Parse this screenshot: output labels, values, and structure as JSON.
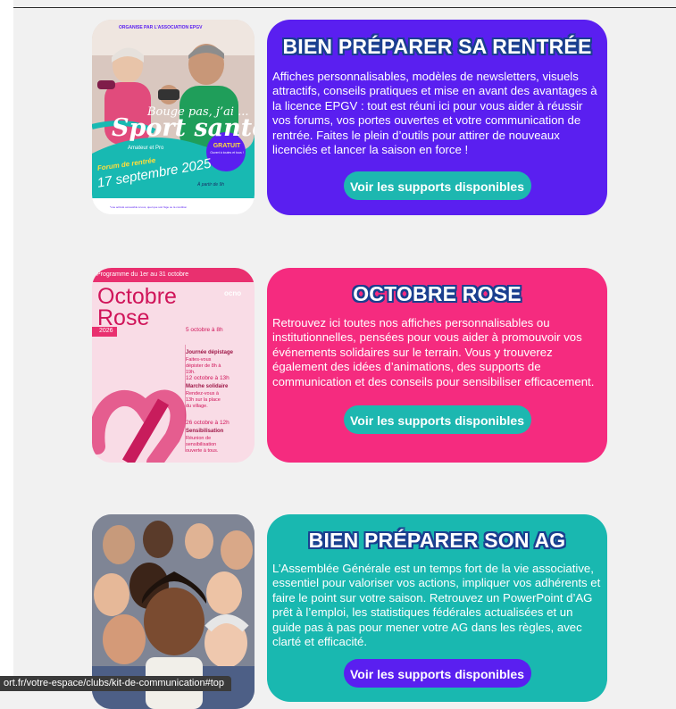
{
  "sections": [
    {
      "title": "BIEN PRÉPARER SA RENTRÉE",
      "description": "Affiches personnalisables, modèles de newsletters, visuels attractifs, conseils pratiques et mise en avant des avantages à la licence EPGV : tout est réuni ici pour vous aider à réussir vos forums, vos portes ouvertes et votre communication de rentrée. Faites le plein d’outils pour attirer de nouveaux licenciés et lancer la saison en force !",
      "button": "Voir les supports disponibles",
      "thumb": {
        "kicker": "ORGANISÉ PAR L’ASSOCIATION EPGV",
        "headline": "Sport santé",
        "tagline": "Bouge pas, j’ai ...",
        "sub": "Amateur et Pro",
        "event": "Forum de rentrée",
        "date": "17 septembre 2025",
        "badge": "GRATUIT",
        "badge_sub": "Ouvert à toutes et tous !",
        "time": "À partir de 9h",
        "footnote": "*une activité accessible à tous, quel que soit l’âge ou la condition"
      }
    },
    {
      "title": "OCTOBRE ROSE",
      "description": "Retrouvez ici toutes nos affiches personnalisables ou institutionnelles, pensées pour vous aider à promouvoir vos événements solidaires sur le terrain. Vous y trouverez également des idées d’animations, des supports de communication et des conseils pour sensibiliser efficacement.",
      "button": "Voir les supports disponibles",
      "thumb": {
        "banner": "Programme du 1er au 31 octobre",
        "headline1": "Octobre",
        "headline2": "Rose",
        "year": "2026",
        "logo": "ocno",
        "events": [
          {
            "date": "5 octobre à 8h",
            "name": "Journée dépistage",
            "desc": "Faites-vous dépister de 8h à 19h."
          },
          {
            "date": "12 octobre à 13h",
            "name": "Marche solidaire",
            "desc": "Rendez-vous à 13h sur la place du village."
          },
          {
            "date": "26 octobre à 12h",
            "name": "Sensibilisation",
            "desc": "Réunion de sensibilisation ouverte à tous."
          }
        ]
      }
    },
    {
      "title": "BIEN PRÉPARER SON AG",
      "description": "L’Assemblée Générale est un temps fort de la vie associative, essentiel pour valoriser vos actions, impliquer vos adhérents et faire le point sur votre saison. Retrouvez un PowerPoint d’AG prêt à l’emploi, les statistiques fédérales actualisées et un guide pas à pas pour mener votre AG dans les règles, avec clarté et efficacité.",
      "button": "Voir les supports disponibles"
    }
  ],
  "status_url": "ort.fr/votre-espace/clubs/kit-de-communication#top",
  "colors": {
    "purple": "#5a1ff0",
    "pink": "#f52b7f",
    "teal": "#19b8b0",
    "button_teal": "#1db7b0",
    "title_outline": "#1a3f8f"
  }
}
